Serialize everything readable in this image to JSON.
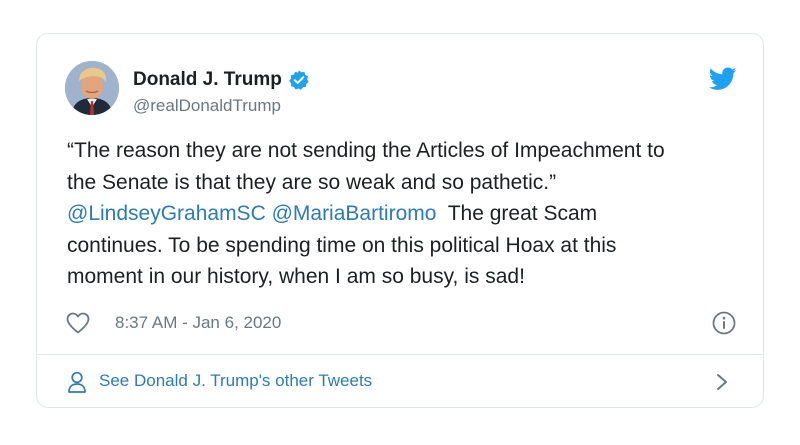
{
  "author": {
    "display_name": "Donald J. Trump",
    "handle": "@realDonaldTrump",
    "verified_icon": "verified-badge-icon",
    "avatar": "profile-photo"
  },
  "brand": {
    "icon": "twitter-bird-icon",
    "accent_color": "#1da1f2",
    "link_color": "#2b7bb9"
  },
  "tweet": {
    "line1": "“The reason they are not sending the Articles of Impeachment to",
    "line2": "the Senate is that they are so weak and so pathetic.”",
    "mention1": "@LindseyGrahamSC",
    "mention2": "@MariaBartiromo",
    "line3_tail": "The great Scam",
    "line4": "continues. To be spending time on this political Hoax at this",
    "line5": "moment in our history, when I am so busy, is sad!"
  },
  "meta": {
    "like_icon": "heart-icon",
    "timestamp": "8:37 AM - Jan 6, 2020",
    "info_icon": "info-icon"
  },
  "footer": {
    "icon": "user-icon",
    "link_text": "See Donald J. Trump's other Tweets",
    "chevron_icon": "chevron-right-icon"
  }
}
